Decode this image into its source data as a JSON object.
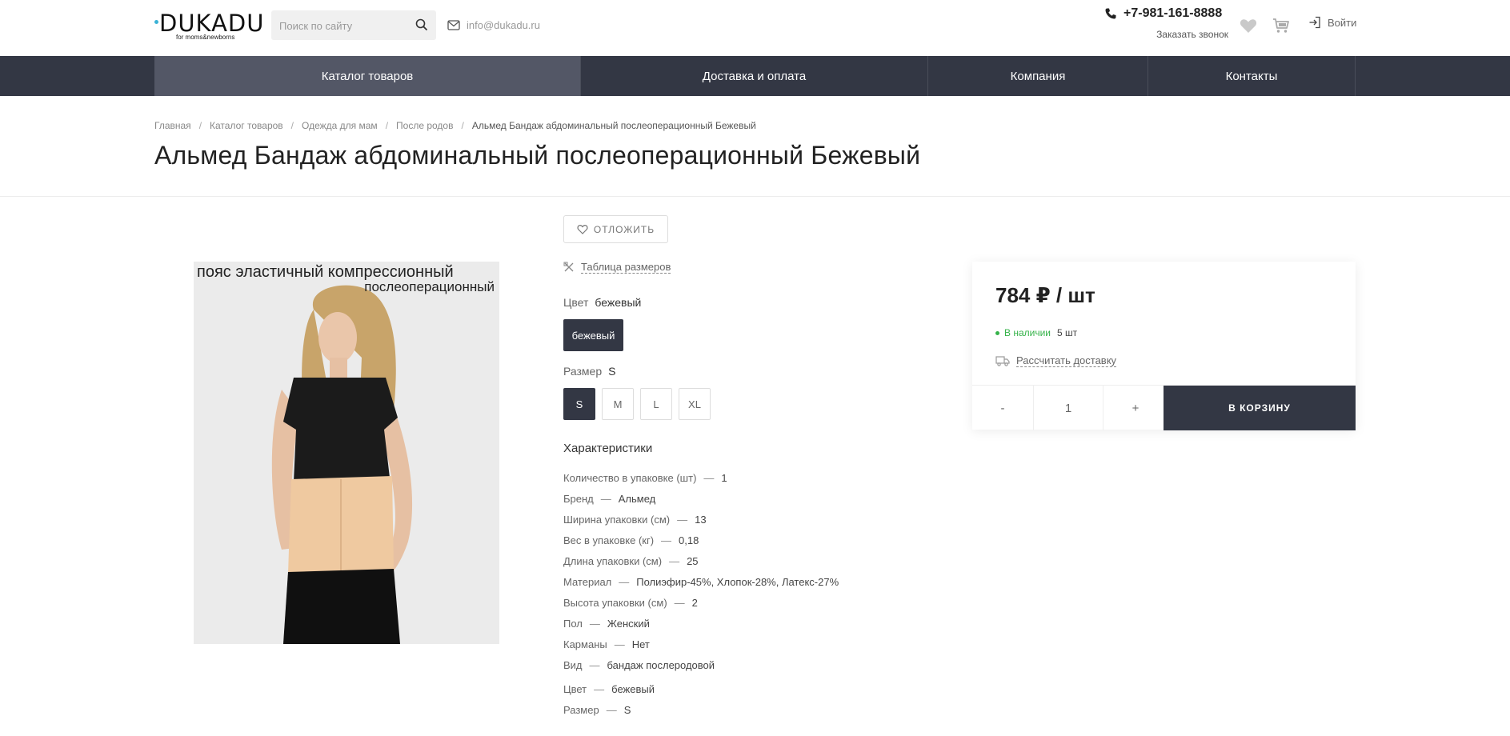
{
  "header": {
    "logo_text": "DUKADU",
    "logo_tagline": "for moms&newborns",
    "search_placeholder": "Поиск по сайту",
    "email": "info@dukadu.ru",
    "phone": "+7-981-161-8888",
    "callback": "Заказать звонок",
    "login": "Войти"
  },
  "nav": {
    "items": [
      {
        "label": "Каталог товаров"
      },
      {
        "label": "Доставка и оплата"
      },
      {
        "label": "Компания"
      },
      {
        "label": "Контакты"
      }
    ]
  },
  "breadcrumbs": [
    "Главная",
    "Каталог товаров",
    "Одежда для мам",
    "После родов",
    "Альмед Бандаж абдоминальный послеоперационный Бежевый"
  ],
  "product": {
    "title": "Альмед Бандаж абдоминальный послеоперационный Бежевый",
    "image_caption_1": "пояс эластичный компрессионный",
    "image_caption_2": "послеоперационный",
    "wishlist_label": "ОТЛОЖИТЬ",
    "size_table_label": "Таблица размеров",
    "color_label": "Цвет",
    "color_value": "бежевый",
    "color_options": [
      "бежевый"
    ],
    "size_label": "Размер",
    "size_value": "S",
    "size_options": [
      "S",
      "M",
      "L",
      "XL"
    ],
    "characteristics_title": "Характеристики",
    "characteristics": [
      {
        "name": "Количество в упаковке (шт)",
        "value": "1"
      },
      {
        "name": "Бренд",
        "value": "Альмед"
      },
      {
        "name": "Ширина упаковки (см)",
        "value": "13"
      },
      {
        "name": "Вес в упаковке (кг)",
        "value": "0,18"
      },
      {
        "name": "Длина упаковки (см)",
        "value": "25"
      },
      {
        "name": "Материал",
        "value": "Полиэфир-45%, Хлопок-28%, Латекс-27%"
      },
      {
        "name": "Высота упаковки (см)",
        "value": "2"
      },
      {
        "name": "Пол",
        "value": "Женский"
      },
      {
        "name": "Карманы",
        "value": "Нет"
      },
      {
        "name": "Вид",
        "value": "бандаж послеродовой"
      },
      {
        "name": "Цвет",
        "value": "бежевый"
      },
      {
        "name": "Размер",
        "value": "S"
      }
    ]
  },
  "buybox": {
    "price": "784 ₽ / шт",
    "stock_status": "В наличии",
    "stock_count": "5 шт",
    "delivery_link": "Рассчитать доставку",
    "qty_minus": "-",
    "qty_value": "1",
    "qty_plus": "+",
    "cart_button": "В КОРЗИНУ"
  },
  "colors": {
    "accent": "#333744",
    "nav_active": "#535766",
    "in_stock": "#36b34a",
    "logo_dot": "#3ab2d6"
  }
}
